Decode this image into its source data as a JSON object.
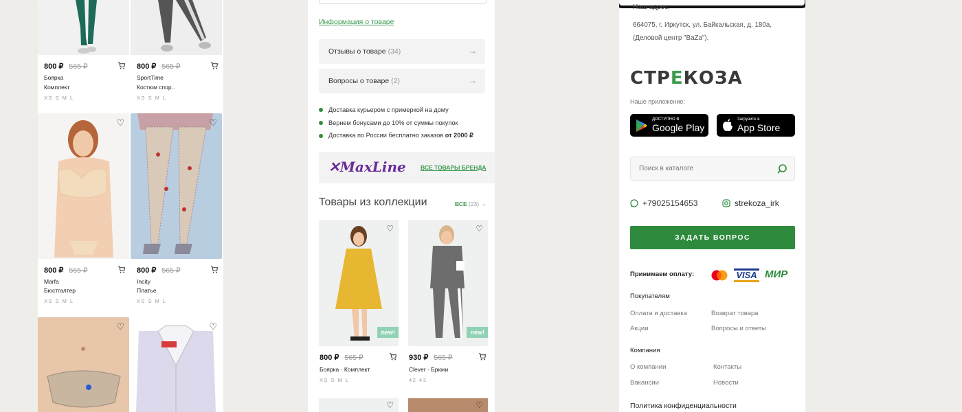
{
  "colors": {
    "accent": "#2e8a3c",
    "link": "#3a9a4e",
    "background": "#efedea"
  },
  "catalog": {
    "cards": [
      {
        "price": "800 ₽",
        "old_price": "565 ₽",
        "brand": "Боярка",
        "title": "Комплект",
        "sizes": "XS S M L"
      },
      {
        "price": "800 ₽",
        "old_price": "565 ₽",
        "brand": "SportTime",
        "title": "Костюм спор..",
        "sizes": "XS S M L"
      },
      {
        "price": "800 ₽",
        "old_price": "565 ₽",
        "brand": "Marfa",
        "title": "Бюстгалтер",
        "sizes": "XS S M L"
      },
      {
        "price": "800 ₽",
        "old_price": "565 ₽",
        "brand": "Incity",
        "title": "Платье",
        "sizes": "XS S M L"
      }
    ]
  },
  "product": {
    "info_link": "Информация о товаре",
    "reviews": {
      "label": "Отзывы о товаре",
      "count": "(34)"
    },
    "questions": {
      "label": "Вопросы о товаре",
      "count": "(2)"
    },
    "benefits": [
      "Доставка курьером с примеркой на дому",
      "Вернем бонусами до 10% от суммы покупок",
      "Доставка по России бесплатно заказов"
    ],
    "benefit_bold": "от 2000 ₽",
    "brand_logo": "MaxLine",
    "brand_all": "ВСЕ ТОВАРЫ БРЕНДА",
    "collection_title": "Товары из коллекции",
    "collection_all": "ВСЕ",
    "collection_count": "(23)",
    "collection_cards": [
      {
        "price": "800 ₽",
        "old_price": "565 ₽",
        "brand": "Боярка · Комплект",
        "sizes": "XS S M L",
        "badge": "new!"
      },
      {
        "price": "930 ₽",
        "old_price": "565 ₽",
        "brand": "Clever · Брюки",
        "sizes": "42 43",
        "badge": "new!"
      }
    ]
  },
  "footer": {
    "address_heading": "Наш адрес:",
    "address_line1": "664075, г. Иркутск, ул. Байкальская, д. 180а,",
    "address_line2": "(Деловой центр \"BaZa\").",
    "logo_left": "СТР",
    "logo_mid": "Е",
    "logo_right": "КОЗА",
    "app_label": "Наше приложение:",
    "google_small": "ДОСТУПНО В",
    "google_big": "Google Play",
    "apple_small": "Загрузите в",
    "apple_big": "App Store",
    "search_placeholder": "Поиск в каталоге",
    "phone": "+79025154653",
    "instagram": "strekoza_irk",
    "ask_button": "ЗАДАТЬ ВОПРОС",
    "pay_label": "Принимаем оплату:",
    "visa": "VISA",
    "mir": "МИР",
    "buyers_heading": "Покупателям",
    "buyers_links": [
      "Оплата и доставка",
      "Возврат товара",
      "Акции",
      "Вопросы и ответы"
    ],
    "company_heading": "Компания",
    "company_links": [
      "О компании",
      "Контакты",
      "Вакансии",
      "Новости"
    ],
    "policy": "Политика конфиденциальности"
  }
}
